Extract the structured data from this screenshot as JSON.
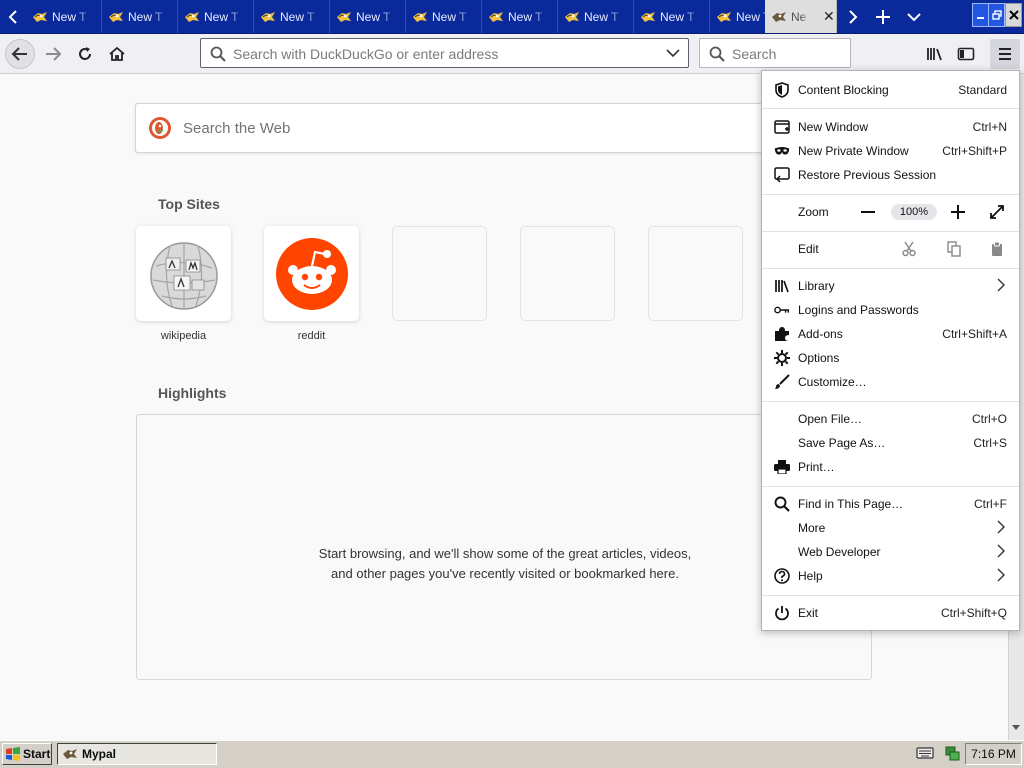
{
  "tabstrip": {
    "tabs": [
      {
        "title": "New T"
      },
      {
        "title": "New T"
      },
      {
        "title": "New T"
      },
      {
        "title": "New T"
      },
      {
        "title": "New T"
      },
      {
        "title": "New T"
      },
      {
        "title": "New T"
      },
      {
        "title": "New T"
      },
      {
        "title": "New T"
      },
      {
        "title": "New T"
      }
    ],
    "active_tab": {
      "title": "Ne",
      "close": "✕"
    }
  },
  "navbar": {
    "address_placeholder": "Search with DuckDuckGo or enter address",
    "search_placeholder": "Search"
  },
  "newtab": {
    "web_search_placeholder": "Search the Web",
    "top_sites_title": "Top Sites",
    "top_sites": [
      {
        "label": "wikipedia"
      },
      {
        "label": "reddit"
      }
    ],
    "highlights_title": "Highlights",
    "highlights_empty_text": "Start browsing, and we'll show some of the great articles, videos, and other pages you've recently visited or bookmarked here."
  },
  "menu": {
    "content_blocking": {
      "label": "Content Blocking",
      "value": "Standard"
    },
    "new_window": {
      "label": "New Window",
      "shortcut": "Ctrl+N"
    },
    "new_private_window": {
      "label": "New Private Window",
      "shortcut": "Ctrl+Shift+P"
    },
    "restore_session": {
      "label": "Restore Previous Session"
    },
    "zoom": {
      "label": "Zoom",
      "value": "100%"
    },
    "edit": {
      "label": "Edit"
    },
    "library": {
      "label": "Library"
    },
    "logins": {
      "label": "Logins and Passwords"
    },
    "addons": {
      "label": "Add-ons",
      "shortcut": "Ctrl+Shift+A"
    },
    "options": {
      "label": "Options"
    },
    "customize": {
      "label": "Customize…"
    },
    "open_file": {
      "label": "Open File…",
      "shortcut": "Ctrl+O"
    },
    "save_page": {
      "label": "Save Page As…",
      "shortcut": "Ctrl+S"
    },
    "print": {
      "label": "Print…"
    },
    "find": {
      "label": "Find in This Page…",
      "shortcut": "Ctrl+F"
    },
    "more": {
      "label": "More"
    },
    "web_developer": {
      "label": "Web Developer"
    },
    "help": {
      "label": "Help"
    },
    "exit": {
      "label": "Exit",
      "shortcut": "Ctrl+Shift+Q"
    }
  },
  "taskbar": {
    "start_label": "Start",
    "task_label": "Mypal",
    "clock": "7:16 PM"
  },
  "colors": {
    "tabstrip_bg": "#0a2a9c",
    "reddit_orange": "#ff4500",
    "ddg_orange": "#de5833"
  }
}
